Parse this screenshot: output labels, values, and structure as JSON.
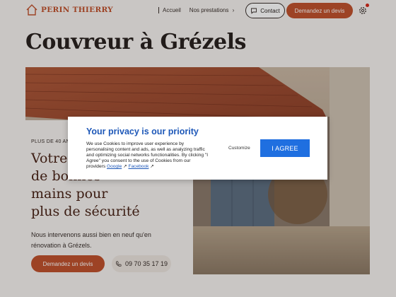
{
  "header": {
    "logo_text": "PERIN THIERRY",
    "nav_accueil": "Accueil",
    "nav_prestations": "Nos prestations",
    "nav_chevron": "›",
    "contact_label": "Contact",
    "devis_label": "Demandez un devis"
  },
  "page": {
    "title": "Couvreur à Grézels"
  },
  "hero": {
    "kicker": "PLUS DE 40 ANS",
    "heading_lines": [
      "Votre",
      "de bonnes",
      "mains pour",
      "plus de sécurité"
    ],
    "description_line1": "Nous intervenons aussi bien en neuf qu'en",
    "description_line2": "rénovation à Grézels.",
    "devis_button": "Demandez un devis",
    "phone": "09 70 35 17 19"
  },
  "cookie_dialog": {
    "title": "Your privacy is our priority",
    "body": "We use Cookies to improve user experience by personalising content and ads, as well as analyzing traffic and optimizing social networks functionalities. By clicking \"I Agree\" you consent to the use of Cookies from our providers",
    "link_google": "Google",
    "link_facebook": "Facebook",
    "customize_label": "Customize",
    "agree_label": "I AGREE"
  },
  "colors": {
    "brand": "#c0522e",
    "dialog_accent": "#1e58b8",
    "agree_button": "#1f6fe0",
    "notification_dot": "#d42a1c"
  }
}
